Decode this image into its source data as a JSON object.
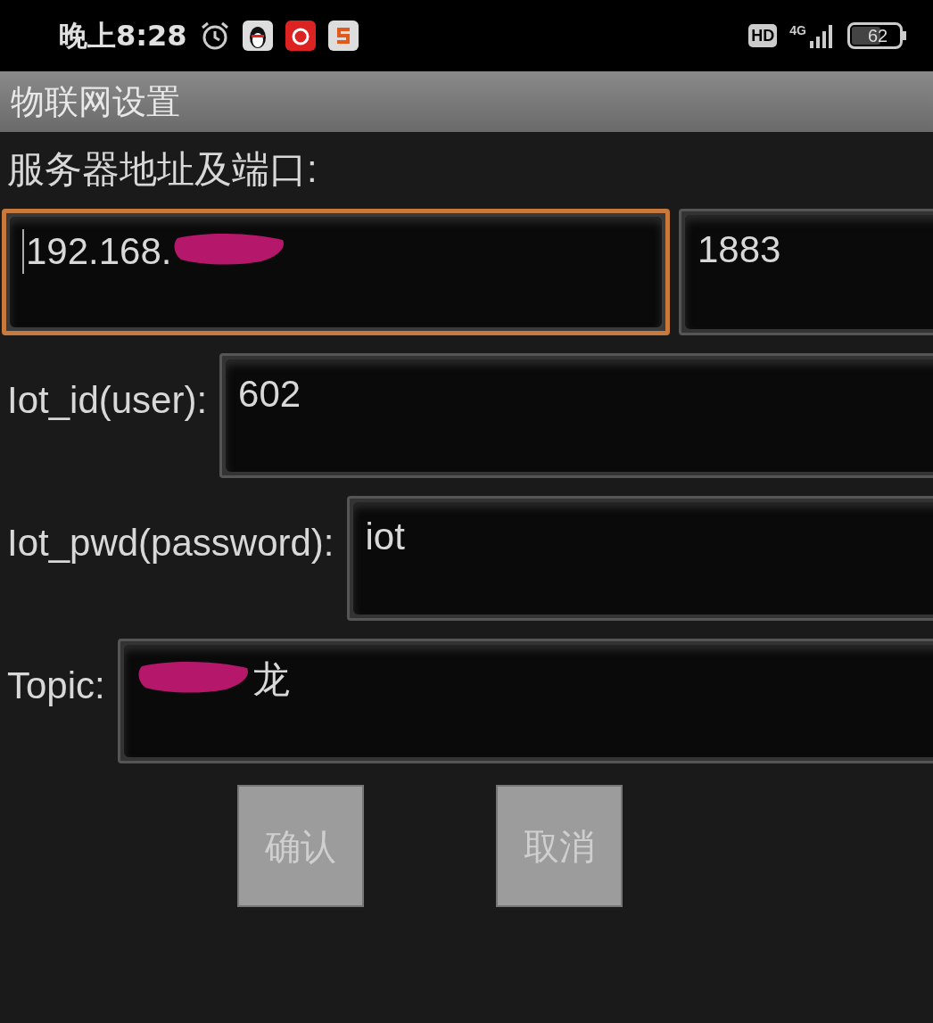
{
  "status_bar": {
    "time": "晚上8:28",
    "hd": "HD",
    "network": "4G",
    "battery": "62"
  },
  "title": "物联网设置",
  "server_label": "服务器地址及端口:",
  "server_fields": [
    {
      "focused": true,
      "parts": [
        {
          "kind": "text",
          "text": "192.168."
        },
        {
          "kind": "scribble"
        }
      ]
    },
    {
      "focused": false,
      "parts": [
        {
          "kind": "text",
          "text": "1883"
        }
      ]
    }
  ],
  "rows": [
    {
      "label": "Iot_id(user):",
      "parts": [
        {
          "kind": "text",
          "text": "602"
        }
      ]
    },
    {
      "label": "Iot_pwd(password):",
      "parts": [
        {
          "kind": "text",
          "text": "iot"
        }
      ]
    },
    {
      "label": "Topic:",
      "parts": [
        {
          "kind": "scribble"
        },
        {
          "kind": "text",
          "text": "龙"
        }
      ]
    }
  ],
  "buttons": [
    {
      "label": "确认",
      "disabled": true
    },
    {
      "label": "取消",
      "disabled": true
    }
  ]
}
